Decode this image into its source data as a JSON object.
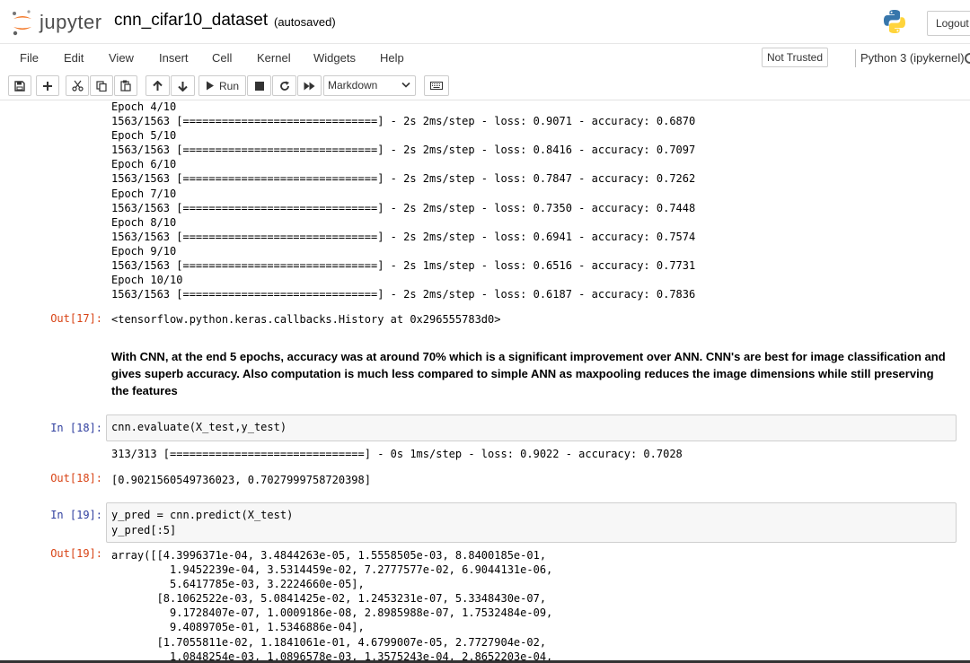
{
  "header": {
    "logo_text": "jupyter",
    "notebook_title": "cnn_cifar10_dataset",
    "autosave_status": "(autosaved)",
    "logout_label": "Logout",
    "colors": {
      "logo_orange": "#f37726",
      "python_blue": "#3776ab",
      "python_yellow": "#ffd43b"
    }
  },
  "menubar": {
    "items": [
      "File",
      "Edit",
      "View",
      "Insert",
      "Cell",
      "Kernel",
      "Widgets",
      "Help"
    ],
    "trust_label": "Not Trusted",
    "kernel_label": "Python 3 (ipykernel)"
  },
  "toolbar": {
    "buttons": [
      "save-icon",
      "plus-icon",
      "scissors-icon",
      "copy-icon",
      "paste-icon",
      "arrow-up-icon",
      "arrow-down-icon",
      "run-icon",
      "stop-icon",
      "restart-icon",
      "fast-forward-icon",
      "keyboard-icon"
    ],
    "run_label": "Run",
    "cell_type": "Markdown"
  },
  "cells": {
    "training_log": [
      "Epoch 4/10",
      "1563/1563 [==============================] - 2s 2ms/step - loss: 0.9071 - accuracy: 0.6870",
      "Epoch 5/10",
      "1563/1563 [==============================] - 2s 2ms/step - loss: 0.8416 - accuracy: 0.7097",
      "Epoch 6/10",
      "1563/1563 [==============================] - 2s 2ms/step - loss: 0.7847 - accuracy: 0.7262",
      "Epoch 7/10",
      "1563/1563 [==============================] - 2s 2ms/step - loss: 0.7350 - accuracy: 0.7448",
      "Epoch 8/10",
      "1563/1563 [==============================] - 2s 2ms/step - loss: 0.6941 - accuracy: 0.7574",
      "Epoch 9/10",
      "1563/1563 [==============================] - 2s 1ms/step - loss: 0.6516 - accuracy: 0.7731",
      "Epoch 10/10",
      "1563/1563 [==============================] - 2s 2ms/step - loss: 0.6187 - accuracy: 0.7836"
    ],
    "out17": {
      "prompt": "Out[17]:",
      "text": "<tensorflow.python.keras.callbacks.History at 0x296555783d0>"
    },
    "markdown": "With CNN, at the end 5 epochs, accuracy was at around 70% which is a significant improvement over ANN. CNN's are best for image classification and gives superb accuracy. Also computation is much less compared to simple ANN as maxpooling reduces the image dimensions while still preserving the features",
    "in18": {
      "prompt": "In [18]:",
      "code": "cnn.evaluate(X_test,y_test)"
    },
    "in18_stream": "313/313 [==============================] - 0s 1ms/step - loss: 0.9022 - accuracy: 0.7028",
    "out18": {
      "prompt": "Out[18]:",
      "text": "[0.9021560549736023, 0.7027999758720398]"
    },
    "in19": {
      "prompt": "In [19]:",
      "code": [
        "y_pred = cnn.predict(X_test)",
        "y_pred[:5]"
      ]
    },
    "out19": {
      "prompt": "Out[19]:",
      "lines": [
        "array([[4.3996371e-04, 3.4844263e-05, 1.5558505e-03, 8.8400185e-01,",
        "         1.9452239e-04, 3.5314459e-02, 7.2777577e-02, 6.9044131e-06,",
        "         5.6417785e-03, 3.2224660e-05],",
        "       [8.1062522e-03, 5.0841425e-02, 1.2453231e-07, 5.3348430e-07,",
        "         9.1728407e-07, 1.0009186e-08, 2.8985988e-07, 1.7532484e-09,",
        "         9.4089705e-01, 1.5346886e-04],",
        "       [1.7055811e-02, 1.1841061e-01, 4.6799007e-05, 2.7727904e-02,",
        "         1.0848254e-03, 1.0896578e-03, 1.3575243e-04, 2.8652203e-04,"
      ]
    }
  }
}
